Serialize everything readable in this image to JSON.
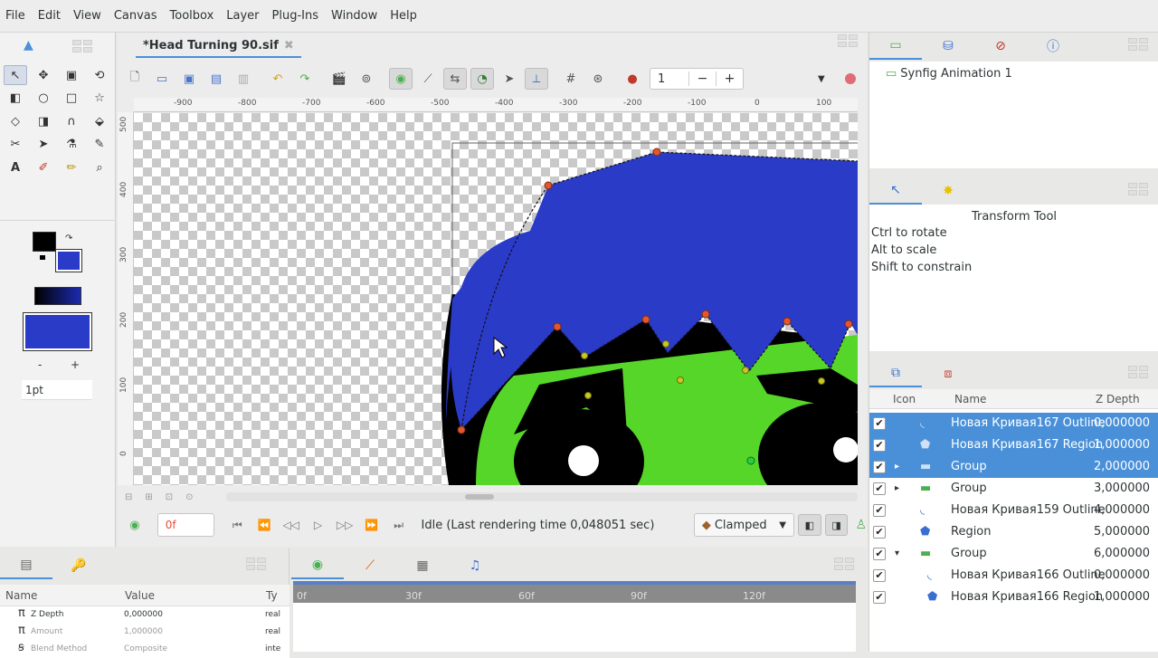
{
  "menu": [
    "File",
    "Edit",
    "View",
    "Canvas",
    "Toolbox",
    "Layer",
    "Plug-Ins",
    "Window",
    "Help"
  ],
  "document": {
    "tab_title": "*Head Turning 90.sif",
    "close_glyph": "✖"
  },
  "toolbar": {
    "frame_value": "1",
    "minus": "−",
    "plus": "+"
  },
  "ruler": {
    "h_ticks": [
      "-900",
      "-800",
      "-700",
      "-600",
      "-500",
      "-400",
      "-300",
      "-200",
      "-100",
      "0",
      "100"
    ],
    "v_ticks": [
      "500",
      "400",
      "300",
      "200",
      "100",
      "0"
    ]
  },
  "toolbox": {
    "brush_minus": "-",
    "brush_plus": "+",
    "brush_size": "1pt"
  },
  "colors": {
    "outline": "#000000",
    "fill": "#2a3bc8",
    "head_green": "#56d628",
    "hair_blue": "#2a3bc8"
  },
  "playback": {
    "time_value": "0f",
    "status": "Idle (Last rendering time 0,048051 sec)",
    "interpolation": "Clamped"
  },
  "canvas_browser": {
    "item": "Synfig Animation 1"
  },
  "tool_options": {
    "title": "Transform Tool",
    "hints": [
      "Ctrl to rotate",
      "Alt to scale",
      "Shift to constrain"
    ]
  },
  "layers": {
    "headers": {
      "icon": "Icon",
      "name": "Name",
      "zdepth": "Z Depth"
    },
    "rows": [
      {
        "name": "Новая Кривая167 Outline",
        "z": "0,000000",
        "selected": true,
        "icon": "outline-icon",
        "expander": ""
      },
      {
        "name": "Новая Кривая167 Region",
        "z": "1,000000",
        "selected": true,
        "icon": "region-icon",
        "expander": ""
      },
      {
        "name": "Group",
        "z": "2,000000",
        "selected": true,
        "icon": "folder-icon",
        "expander": "▸"
      },
      {
        "name": "Group",
        "z": "3,000000",
        "selected": false,
        "icon": "folder-icon",
        "expander": "▸"
      },
      {
        "name": "Новая Кривая159 Outline",
        "z": "4,000000",
        "selected": false,
        "icon": "outline-icon",
        "expander": ""
      },
      {
        "name": "Region",
        "z": "5,000000",
        "selected": false,
        "icon": "region-icon",
        "expander": ""
      },
      {
        "name": "Group",
        "z": "6,000000",
        "selected": false,
        "icon": "folder-icon",
        "expander": "▾"
      },
      {
        "name": "Новая Кривая166 Outline",
        "z": "0,000000",
        "selected": false,
        "icon": "outline-icon",
        "expander": ""
      },
      {
        "name": "Новая Кривая166 Region",
        "z": "1,000000",
        "selected": false,
        "icon": "region-icon",
        "expander": ""
      }
    ]
  },
  "params": {
    "headers": {
      "name": "Name",
      "value": "Value",
      "type": "Ty"
    },
    "rows": [
      {
        "name": "Z Depth",
        "value": "0,000000",
        "type": "real"
      },
      {
        "name": "Amount",
        "value": "1,000000",
        "type": "real"
      },
      {
        "name": "Blend Method",
        "value": "Composite",
        "type": "inte"
      }
    ]
  },
  "timetrack": {
    "ticks": [
      "0f",
      "30f",
      "60f",
      "90f",
      "120f"
    ]
  }
}
